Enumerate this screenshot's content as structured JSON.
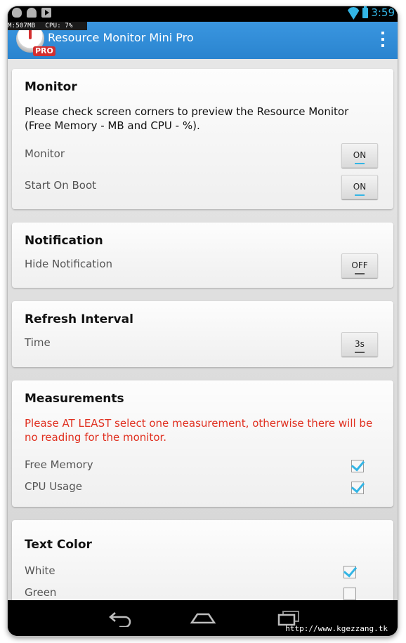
{
  "status_bar": {
    "time": "3:59"
  },
  "overlay": {
    "memory": "M:507MB",
    "cpu": "CPU: 7%"
  },
  "app_bar": {
    "title": "Resource Monitor Mini Pro",
    "badge": "PRO"
  },
  "monitor": {
    "title": "Monitor",
    "description": "Please check screen corners to preview the Resource Monitor (Free Memory - MB and CPU - %).",
    "monitor_label": "Monitor",
    "monitor_state": "ON",
    "boot_label": "Start On Boot",
    "boot_state": "ON"
  },
  "notification": {
    "title": "Notification",
    "hide_label": "Hide Notification",
    "hide_state": "OFF"
  },
  "refresh": {
    "title": "Refresh Interval",
    "time_label": "Time",
    "time_value": "3s"
  },
  "measurements": {
    "title": "Measurements",
    "warning": "Please AT LEAST select one measurement, otherwise there will be no reading for the monitor.",
    "free_memory_label": "Free Memory",
    "free_memory_checked": true,
    "cpu_label": "CPU Usage",
    "cpu_checked": true
  },
  "text_color": {
    "title": "Text Color",
    "white_label": "White",
    "white_checked": true,
    "green_label": "Green",
    "green_checked": false
  },
  "footer": {
    "url": "http://www.kgezzang.tk"
  },
  "colors": {
    "accent": "#33b5e5",
    "action_bar": "#2e8bd6",
    "warning": "#e03020"
  }
}
